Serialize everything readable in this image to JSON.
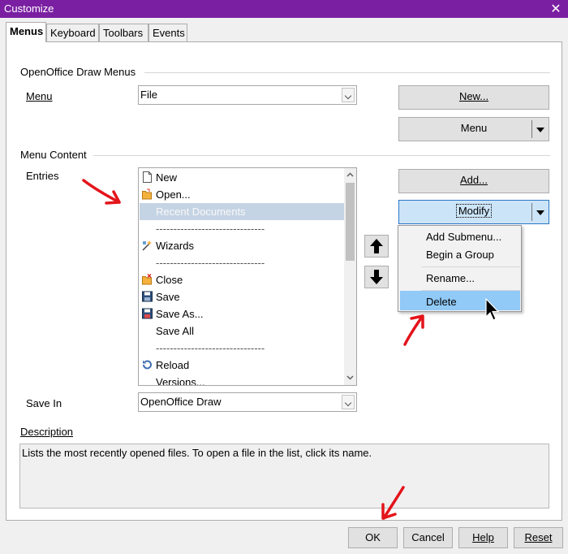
{
  "window": {
    "title": "Customize",
    "close_glyph": "✕"
  },
  "tabs": [
    "Menus",
    "Keyboard",
    "Toolbars",
    "Events"
  ],
  "menus_group": {
    "title": "OpenOffice Draw Menus",
    "menu_label": "Menu",
    "menu_value": "File",
    "new_button": "New...",
    "menu_button": "Menu"
  },
  "content_group": {
    "title": "Menu Content",
    "entries_label": "Entries",
    "entries": [
      {
        "label": "New",
        "icon": "new-document-icon"
      },
      {
        "label": "Open...",
        "icon": "open-folder-icon"
      },
      {
        "label": "Recent Documents",
        "icon": "",
        "selected": true
      },
      {
        "label": "-------------------------------",
        "icon": "",
        "separator": true
      },
      {
        "label": "Wizards",
        "icon": "wizard-icon"
      },
      {
        "label": "-------------------------------",
        "icon": "",
        "separator": true
      },
      {
        "label": "Close",
        "icon": "close-folder-icon"
      },
      {
        "label": "Save",
        "icon": "save-icon"
      },
      {
        "label": "Save As...",
        "icon": "save-as-icon"
      },
      {
        "label": "Save All",
        "icon": ""
      },
      {
        "label": "-------------------------------",
        "icon": "",
        "separator": true
      },
      {
        "label": "Reload",
        "icon": "reload-icon"
      },
      {
        "label": "Versions...",
        "icon": ""
      }
    ],
    "add_button": "Add...",
    "modify_button": "Modify",
    "modify_menu": [
      "Add Submenu...",
      "Begin a Group",
      "Rename...",
      "Delete"
    ],
    "save_in_label": "Save In",
    "save_in_value": "OpenOffice Draw"
  },
  "description": {
    "label": "Description",
    "text": "Lists the most recently opened files. To open a file in the list, click its name."
  },
  "footer": {
    "ok": "OK",
    "cancel": "Cancel",
    "help": "Help",
    "reset": "Reset"
  },
  "colors": {
    "titlebar": "#7a1fa2",
    "annotation_arrow": "#e4141b",
    "highlight": "#91c9f7"
  }
}
